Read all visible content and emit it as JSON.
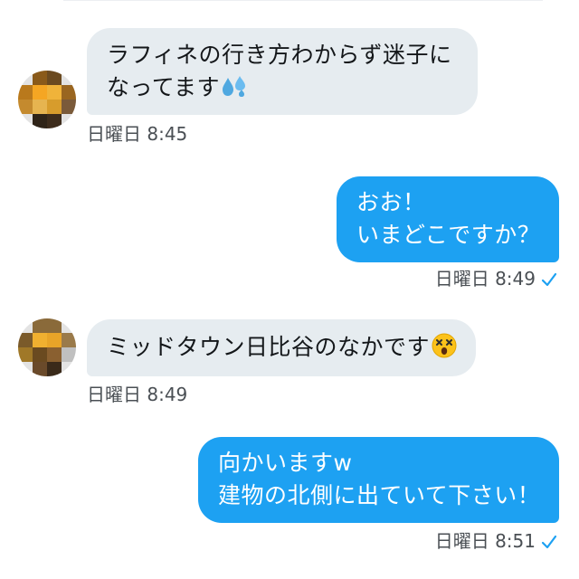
{
  "messages": [
    {
      "direction": "incoming",
      "lines": [
        "ラフィネの行き方わからず迷子に",
        "なってます"
      ],
      "emoji": "sweat-droplets-icon",
      "time": "日曜日 8:45"
    },
    {
      "direction": "outgoing",
      "lines": [
        "おお！",
        "いまどこですか？"
      ],
      "time": "日曜日 8:49",
      "status": "sent-check-icon"
    },
    {
      "direction": "incoming",
      "lines": [
        "ミッドタウン日比谷のなかです"
      ],
      "emoji": "dizzy-face-icon",
      "time": "日曜日 8:49"
    },
    {
      "direction": "outgoing",
      "lines": [
        "向かいますw",
        "建物の北側に出ていて下さい！"
      ],
      "time": "日曜日 8:51",
      "status": "sent-check-icon"
    }
  ],
  "colors": {
    "incoming_bubble": "#e6ecf0",
    "outgoing_bubble": "#1da1f2",
    "check": "#1da1f2"
  }
}
